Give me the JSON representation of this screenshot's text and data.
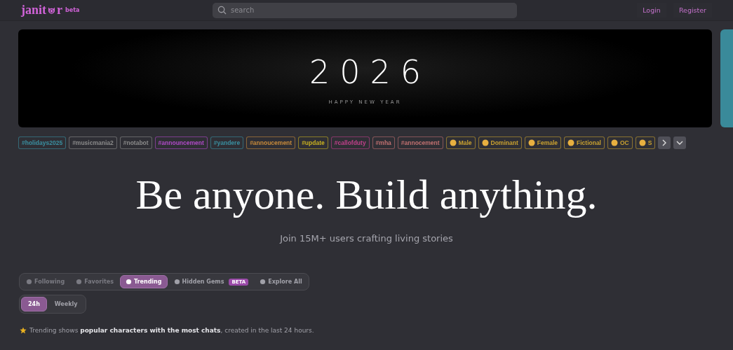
{
  "header": {
    "logo": {
      "before": "janit",
      "after": "r",
      "badge": "beta"
    },
    "search": {
      "placeholder": "search"
    },
    "links": [
      "Login",
      "Register"
    ]
  },
  "banner": {
    "year": "2026",
    "caption": "HAPPY NEW YEAR"
  },
  "tags": [
    {
      "label": "#holidays2025",
      "kind": "hashtag",
      "color": "#3a8fa0"
    },
    {
      "label": "#musicmania2",
      "kind": "hashtag",
      "color": "#8a8a8a"
    },
    {
      "label": "#notabot",
      "kind": "hashtag",
      "color": "#8a8a8a"
    },
    {
      "label": "#announcement",
      "kind": "hashtag",
      "color": "#b04ac8"
    },
    {
      "label": "#yandere",
      "kind": "hashtag",
      "color": "#3a8fa0"
    },
    {
      "label": "#annoucement",
      "kind": "hashtag",
      "color": "#c88a3a"
    },
    {
      "label": "#update",
      "kind": "hashtag",
      "color": "#c8b020"
    },
    {
      "label": "#callofduty",
      "kind": "hashtag",
      "color": "#c0408a"
    },
    {
      "label": "#mha",
      "kind": "hashtag",
      "color": "#c07070"
    },
    {
      "label": "#annocement",
      "kind": "hashtag",
      "color": "#c07070"
    },
    {
      "label": "Male",
      "kind": "emoji",
      "color": "#c8a030"
    },
    {
      "label": "Dominant",
      "kind": "emoji",
      "color": "#c8a030"
    },
    {
      "label": "Female",
      "kind": "emoji",
      "color": "#c8a030"
    },
    {
      "label": "Fictional",
      "kind": "emoji",
      "color": "#c8a030"
    },
    {
      "label": "OC",
      "kind": "emoji",
      "color": "#c8a030"
    },
    {
      "label": "S",
      "kind": "emoji",
      "color": "#c8a030"
    }
  ],
  "hero": {
    "headline": "Be anyone. Build anything.",
    "subtitle": "Join 15M+ users crafting living stories"
  },
  "tabs": [
    {
      "label": "Following",
      "selected": false,
      "disabled": true
    },
    {
      "label": "Favorites",
      "selected": false,
      "disabled": true
    },
    {
      "label": "Trending",
      "selected": true,
      "disabled": false
    },
    {
      "label": "Hidden Gems",
      "selected": false,
      "disabled": false,
      "badge": "BETA"
    },
    {
      "label": "Explore All",
      "selected": false,
      "disabled": false
    }
  ],
  "periods": [
    {
      "label": "24h",
      "selected": true
    },
    {
      "label": "Weekly",
      "selected": false
    }
  ],
  "note": "Trending shows **popular characters with the most chats**, created in the last 24 hours."
}
